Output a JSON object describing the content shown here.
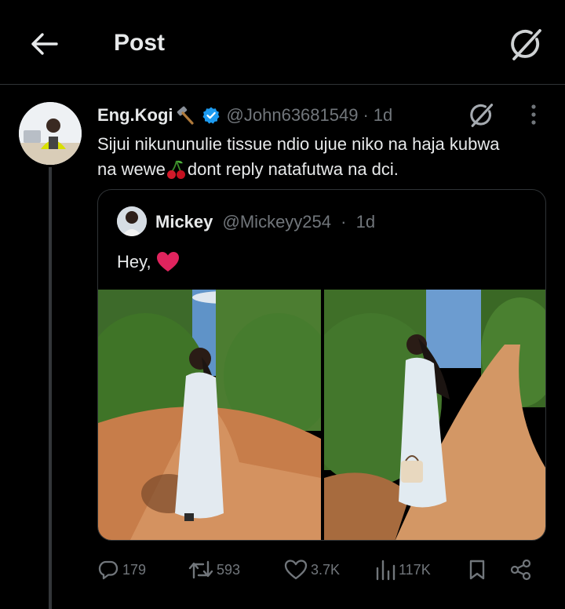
{
  "header": {
    "title": "Post",
    "back_icon": "arrow-left-icon",
    "grok_icon": "grok-icon"
  },
  "tweet": {
    "name": "Eng.Kogi",
    "name_emoji": "hammer",
    "verified": true,
    "handle": "@John63681549",
    "separator": "·",
    "time": "1d",
    "text_line1": "Sijui nikununulie tissue ndio ujue niko na haja kubwa",
    "text_line2_before": "na wewe",
    "text_line2_emoji": "cherries",
    "text_line2_after": "dont reply natafutwa na dci."
  },
  "quote": {
    "name": "Mickey",
    "handle": "@Mickeyy254",
    "separator": "·",
    "time": "1d",
    "text": "Hey,",
    "text_emoji": "red-heart"
  },
  "actions": {
    "replies": "179",
    "reposts": "593",
    "likes": "3.7K",
    "views": "117K"
  },
  "colors": {
    "background": "#000000",
    "text": "#e7e9ea",
    "secondary": "#71767b",
    "border": "#2f3336",
    "verified": "#1d9bf0",
    "heart": "#e0245e"
  }
}
